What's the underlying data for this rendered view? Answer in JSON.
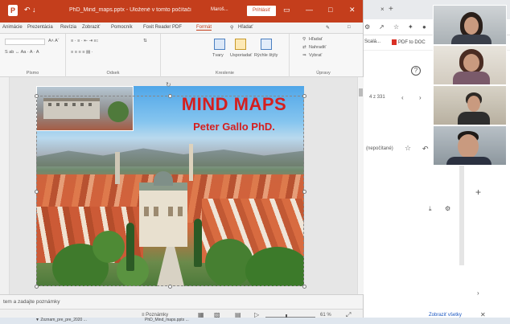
{
  "powerpoint": {
    "app_badge": "P",
    "quick_access": "↶ ↓",
    "document_title": "PhD_Mind_maps.pptx - Uložené v tomto počítači",
    "user_label": "Maroš...",
    "signin_label": "Prihlásiť",
    "window_controls": [
      "▭",
      "—",
      "□",
      "✕"
    ],
    "ribbon_tabs": [
      "Animácie",
      "Prezentácia",
      "Revízia",
      "Zobraziť",
      "Pomocník",
      "Foxit Reader PDF",
      "Formát",
      "Hľadať"
    ],
    "active_tab": "Formát",
    "ribbon_groups": {
      "font_label": "Písmo",
      "paragraph_label": "Odsek",
      "drawing_label": "Kreslenie",
      "editing_label": "Úpravy",
      "shapes_label": "Tvary",
      "arrange_label": "Usporiadať",
      "quick_styles_label": "Rýchle štýly",
      "find_label": "Hľadať",
      "replace_label": "Nahradiť",
      "select_label": "Vybrať"
    },
    "notes_placeholder": "tem a zadajte poznámky",
    "statusbar": {
      "notes_label": "≡ Poznámky",
      "zoom_percent": "61 %"
    }
  },
  "slide": {
    "title": "MIND MAPS",
    "subtitle": "Peter Gallo PhD."
  },
  "browser": {
    "new_tab": "+",
    "close_tab": "×",
    "bookmark_1": "Scalá...",
    "bookmark_2": "PDF to DOC",
    "page_counter": "4 z 331",
    "status_text": "(nepočítané)",
    "bottom_link": "Zobraziť všetky",
    "bottom_close": "✕"
  },
  "taskbar": {
    "item_1": "▼  Zoznam_pre_pre_2020 ...",
    "item_2": "PhD_Mind_maps.pptx ..."
  },
  "colors": {
    "ppt_accent": "#c43e1c",
    "title_red": "#d41f1f"
  }
}
